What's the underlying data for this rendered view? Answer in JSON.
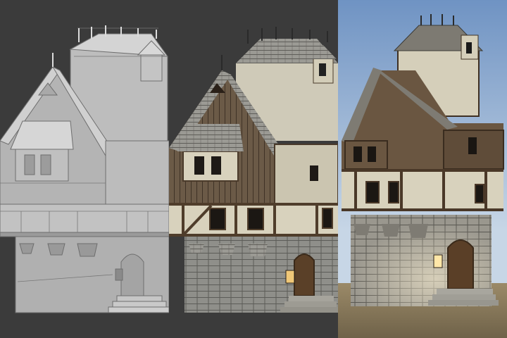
{
  "scene": {
    "panels": [
      {
        "id": "wireframe-grey",
        "kind": "untextured-model"
      },
      {
        "id": "textured",
        "kind": "textured-model"
      },
      {
        "id": "rendered",
        "kind": "final-render"
      }
    ],
    "colors": {
      "viewport_bg": "#3b3b3b",
      "grey_wall": "#b9b9b9",
      "grey_roof": "#cfcfcf",
      "grey_edge": "#6e6e6e",
      "timber": "#5a4632",
      "plaster": "#d8d2bd",
      "stone": "#8f8f8a",
      "roof_shingle": "#9b9a94",
      "sky_top": "#6f93c3",
      "sky_bottom": "#c7d6e6",
      "ground": "#8a7b5f"
    }
  }
}
